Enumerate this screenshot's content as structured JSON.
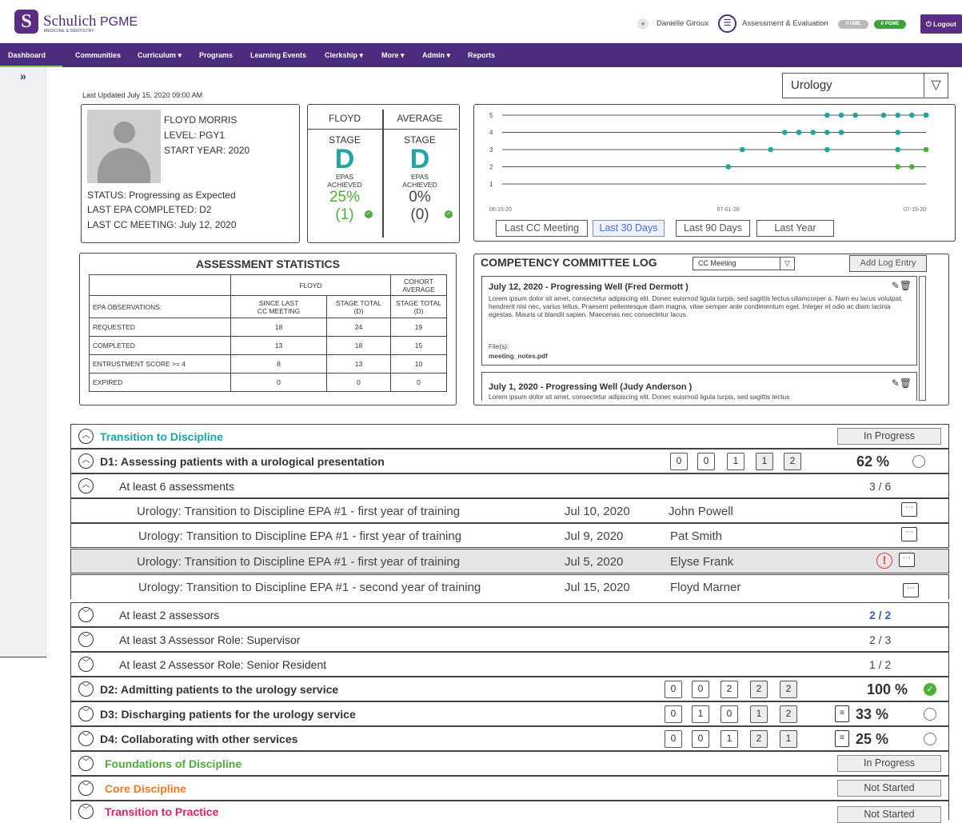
{
  "header": {
    "brand_name": "Schulich",
    "brand_sub": "MEDICINE & DENTISTRY",
    "app_name": "PGME",
    "user_name": "Danielle Giroux",
    "ae_label": "Assessment & Evaluation",
    "badge_ume": "0 UME",
    "badge_pgme": "0 PGME",
    "logout_label": "Logout"
  },
  "nav": {
    "items": [
      "Dashboard",
      "Communities",
      "Curriculum ▾",
      "Programs",
      "Learning Events",
      "Clerkship ▾",
      "More ▾",
      "Admin ▾",
      "Reports"
    ],
    "active": "Dashboard"
  },
  "program_select": {
    "value": "Urology"
  },
  "last_updated": "Last Updated July 15, 2020 09:00 AM",
  "profile": {
    "name": "FLOYD MORRIS",
    "level": "LEVEL: PGY1",
    "start_year": "START YEAR: 2020",
    "status": "STATUS: Progressing as Expected",
    "last_epa": "LAST EPA COMPLETED: D2",
    "last_cc": "LAST CC MEETING: July 12, 2020"
  },
  "stage": {
    "resident": {
      "header": "FLOYD",
      "stage_label": "STAGE",
      "letter": "D",
      "epas_label_1": "EPAS",
      "epas_label_2": "ACHIEVED",
      "pct": "25%",
      "count": "(1)"
    },
    "average": {
      "header": "AVERAGE",
      "stage_label": "STAGE",
      "letter": "D",
      "epas_label_1": "EPAS",
      "epas_label_2": "ACHIEVED",
      "pct": "0%",
      "count": "(0)"
    }
  },
  "chart_data": {
    "type": "scatter",
    "x_tick_labels": [
      "06-15-20",
      "07-01-20",
      "07-15-20"
    ],
    "xlim": [
      "06-15-20",
      "07-15-20"
    ],
    "ylim": [
      1,
      5
    ],
    "y_ticks": [
      1,
      2,
      3,
      4,
      5
    ],
    "grid": true,
    "points": [
      {
        "x": "07-01-20",
        "y": 2,
        "color": "#1da6a4"
      },
      {
        "x": "07-02-20",
        "y": 3,
        "color": "#1da6a4"
      },
      {
        "x": "07-04-20",
        "y": 3,
        "color": "#1da6a4"
      },
      {
        "x": "07-08-20",
        "y": 3,
        "color": "#1da6a4"
      },
      {
        "x": "07-05-20",
        "y": 4,
        "color": "#1da6a4"
      },
      {
        "x": "07-06-20",
        "y": 4,
        "color": "#1da6a4"
      },
      {
        "x": "07-06-20",
        "y": 4,
        "color": "#1da6a4"
      },
      {
        "x": "07-07-20",
        "y": 4,
        "color": "#1da6a4"
      },
      {
        "x": "07-08-20",
        "y": 4,
        "color": "#1da6a4"
      },
      {
        "x": "07-09-20",
        "y": 4,
        "color": "#1da6a4"
      },
      {
        "x": "07-13-20",
        "y": 4,
        "color": "#1da6a4"
      },
      {
        "x": "07-08-20",
        "y": 5,
        "color": "#1da6a4"
      },
      {
        "x": "07-09-20",
        "y": 5,
        "color": "#1da6a4"
      },
      {
        "x": "07-10-20",
        "y": 5,
        "color": "#1da6a4"
      },
      {
        "x": "07-12-20",
        "y": 5,
        "color": "#1da6a4"
      },
      {
        "x": "07-13-20",
        "y": 5,
        "color": "#1da6a4"
      },
      {
        "x": "07-14-20",
        "y": 5,
        "color": "#1da6a4"
      },
      {
        "x": "07-15-20",
        "y": 5,
        "color": "#1da6a4"
      },
      {
        "x": "07-15-20",
        "y": 5,
        "color": "#1da6a4"
      },
      {
        "x": "07-13-20",
        "y": 3,
        "color": "#1da6a4"
      },
      {
        "x": "07-15-20",
        "y": 3,
        "color": "#4caf37"
      },
      {
        "x": "07-13-20",
        "y": 2,
        "color": "#4caf37"
      },
      {
        "x": "07-14-20",
        "y": 2,
        "color": "#4caf37"
      }
    ],
    "range_buttons": [
      "Last CC Meeting",
      "Last 30 Days",
      "Last 90 Days",
      "Last Year"
    ],
    "active_range": "Last 30 Days"
  },
  "stats": {
    "title": "ASSESSMENT STATISTICS",
    "group_resident": "FLOYD",
    "group_cohort_1": "COHORT",
    "group_cohort_2": "AVERAGE",
    "row_label_header": "EPA OBSERVATIONS:",
    "col_since_1": "SINCE LAST",
    "col_since_2": "CC MEETING",
    "col_stage_1": "STAGE TOTAL",
    "col_stage_2": "(D)",
    "col_cohort_1": "STAGE TOTAL",
    "col_cohort_2": "(D)",
    "rows": [
      {
        "label": "REQUESTED",
        "since": "18",
        "stage": "24",
        "cohort": "19"
      },
      {
        "label": "COMPLETED",
        "since": "13",
        "stage": "18",
        "cohort": "15"
      },
      {
        "label": "ENTRUSTMENT SCORE >= 4",
        "since": "8",
        "stage": "13",
        "cohort": "10"
      },
      {
        "label": "EXPIRED",
        "since": "0",
        "stage": "0",
        "cohort": "0"
      }
    ]
  },
  "ccl": {
    "title": "COMPETENCY COMMITTEE LOG",
    "filter": "CC Meeting",
    "add_label": "Add Log Entry",
    "entries": [
      {
        "heading": "July 12, 2020 - Progressing Well (Fred Dermott )",
        "body": "Lorem ipsum dolor sit amet, consectetur adipiscing elit. Donec euismod ligula turpis, sed sagittis lectus ullamcorper a. Nam eu lacus volutpat, hendrerit nisi nec, varius tellus. Praesent pellentesque diam magna, vitae semper ante condimentum eget. Integer et odio ac diam lacinia egestas. Mauris ut blandit sapien. Maecenas nec consectetur lacus.",
        "files_label": "File(s):",
        "file": "meeting_notes.pdf"
      },
      {
        "heading": "July 1, 2020 - Progressing Well (Judy Anderson )",
        "body": "Lorem ipsum dolor sit amet, consectetur adipiscing elit. Donec euismod ligula turpis, sed sagittis lectus"
      }
    ]
  },
  "epa_list": {
    "stage_ttd": {
      "title": "Transition to Discipline",
      "status": "In Progress"
    },
    "d1": {
      "title": "D1: Assessing patients with a urological presentation",
      "scores": [
        "0",
        "0",
        "1",
        "1",
        "2"
      ],
      "pct": "62 %"
    },
    "d1_req1": {
      "title": "At least 6 assessments",
      "count": "3 / 6"
    },
    "assessments": [
      {
        "title": "Urology: Transition to Discipline EPA #1 - first year of training",
        "date": "Jul 10, 2020",
        "assessor": "John Powell"
      },
      {
        "title": "Urology: Transition to Discipline EPA #1 - first year of training",
        "date": "Jul 9, 2020",
        "assessor": "Pat Smith"
      },
      {
        "title": "Urology: Transition to Discipline EPA #1 - first year of training",
        "date": "Jul 5, 2020",
        "assessor": "Elyse Frank"
      },
      {
        "title": "Urology: Transition to Discipline EPA #1 - second year of training",
        "date": "Jul 15, 2020",
        "assessor": "Floyd Marner"
      }
    ],
    "d1_req2": {
      "title": "At least 2 assessors",
      "count": "2 / 2"
    },
    "d1_req3": {
      "title": "At least 3 Assessor Role: Supervisor",
      "count": "2 / 3"
    },
    "d1_req4": {
      "title": "At least 2 Assessor Role: Senior Resident",
      "count": "1 / 2"
    },
    "d2": {
      "title": "D2: Admitting patients to the urology service",
      "scores": [
        "0",
        "0",
        "2",
        "2",
        "2"
      ],
      "pct": "100 %"
    },
    "d3": {
      "title": "D3: Discharging patients for the urology service",
      "scores": [
        "0",
        "1",
        "0",
        "1",
        "2"
      ],
      "pct": "33 %"
    },
    "d4": {
      "title": "D4: Collaborating with other services",
      "scores": [
        "0",
        "0",
        "1",
        "2",
        "1"
      ],
      "pct": "25 %"
    },
    "stage_fod": {
      "title": "Foundations of Discipline",
      "status": "In Progress"
    },
    "stage_core": {
      "title": "Core Discipline",
      "status": "Not Started"
    },
    "stage_ttp": {
      "title": "Transition to Practice",
      "status": "Not Started"
    }
  }
}
